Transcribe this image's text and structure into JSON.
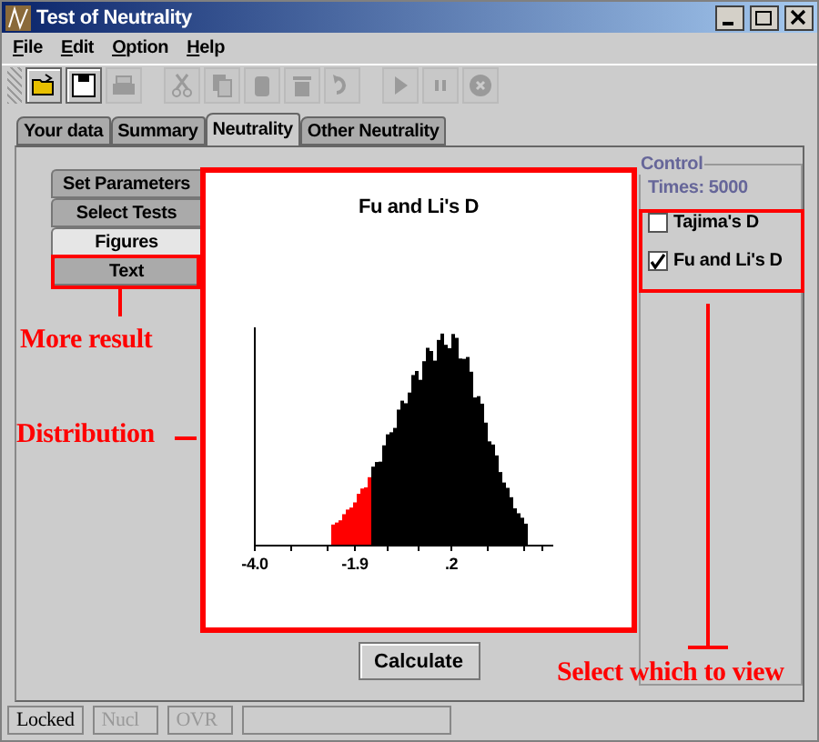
{
  "window": {
    "title": "Test of Neutrality"
  },
  "menu": [
    {
      "label": "File"
    },
    {
      "label": "Edit"
    },
    {
      "label": "Option"
    },
    {
      "label": "Help"
    }
  ],
  "toolbar": [
    {
      "kind": "open",
      "disabled": false
    },
    {
      "kind": "save",
      "disabled": false
    },
    {
      "kind": "print",
      "disabled": true
    },
    {
      "kind": "cut",
      "disabled": true
    },
    {
      "kind": "copy",
      "disabled": true
    },
    {
      "kind": "paste",
      "disabled": true
    },
    {
      "kind": "delete",
      "disabled": true
    },
    {
      "kind": "redo",
      "disabled": true
    },
    {
      "kind": "play",
      "disabled": true
    },
    {
      "kind": "pause",
      "disabled": true
    },
    {
      "kind": "stop",
      "disabled": true
    }
  ],
  "tabs": [
    {
      "label": "Your data",
      "selected": false
    },
    {
      "label": "Summary",
      "selected": false
    },
    {
      "label": "Neutrality",
      "selected": true
    },
    {
      "label": "Other Neutrality",
      "selected": false
    }
  ],
  "side_tabs": [
    {
      "label": "Set Parameters",
      "selected": false
    },
    {
      "label": "Select Tests",
      "selected": false
    },
    {
      "label": "Figures",
      "selected": true
    },
    {
      "label": "Text",
      "selected": false
    }
  ],
  "figure": {
    "title": "Fu and Li's D",
    "x_tick_labels": [
      "-4.0",
      "-1.9",
      ".2"
    ]
  },
  "control": {
    "title": "Control",
    "times": "Times: 5000",
    "tests": [
      {
        "label": "Tajima's D",
        "checked": false
      },
      {
        "label": "Fu and Li's D",
        "checked": true
      }
    ]
  },
  "button": "Calculate",
  "annotations": {
    "side_tabs": "More result",
    "figure": "Distribution",
    "control": "Select which to view"
  },
  "status_bar": [
    {
      "text": "Locked",
      "disabled": false
    },
    {
      "text": "Nucl",
      "disabled": true
    },
    {
      "text": "OVR",
      "disabled": true
    }
  ]
}
